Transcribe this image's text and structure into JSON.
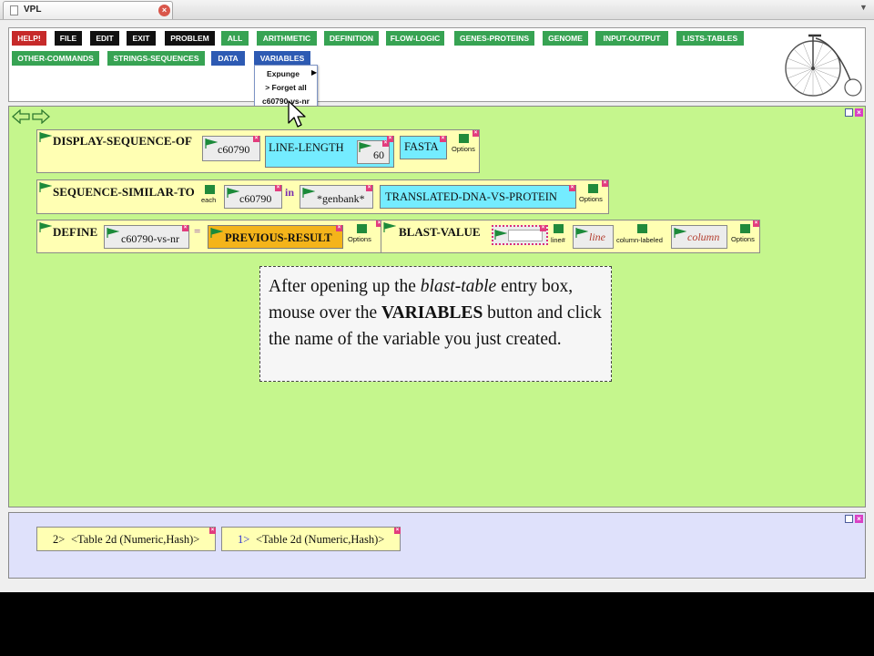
{
  "browser": {
    "tab_title": "VPL"
  },
  "menu_bar": {
    "row1": [
      "HELP!",
      "FILE",
      "EDIT",
      "EXIT",
      "PROBLEM",
      "ALL",
      "ARITHMETIC",
      "DEFINITION",
      "FLOW-LOGIC",
      "GENES-PROTEINS",
      "GENOME",
      "INPUT-OUTPUT",
      "LISTS-TABLES"
    ],
    "row2": [
      "OTHER-COMMANDS",
      "STRINGS-SEQUENCES",
      "DATA",
      "VARIABLES"
    ]
  },
  "variables_menu": {
    "expunge": "Expunge",
    "forget_all": "> Forget all",
    "variable": "c60790-vs-nr"
  },
  "workspace": {
    "block1": {
      "keyword": "DISPLAY-SEQUENCE-OF",
      "arg": "c60790",
      "line_length": "LINE-LENGTH",
      "line_length_value": "60",
      "fasta": "FASTA",
      "options": "Options"
    },
    "block2": {
      "keyword": "SEQUENCE-SIMILAR-TO",
      "each": "each",
      "arg": "c60790",
      "in": "in",
      "db": "*genbank*",
      "method": "TRANSLATED-DNA-VS-PROTEIN",
      "options": "Options"
    },
    "block3": {
      "keyword": "DEFINE",
      "var": "c60790-vs-nr",
      "eq": "=",
      "value": "PREVIOUS-RESULT",
      "options": "Options"
    },
    "block4": {
      "keyword": "BLAST-VALUE",
      "line_label": "line#",
      "line_placeholder": "line",
      "col_label": "column-labeled",
      "col_placeholder": "column",
      "options": "Options"
    }
  },
  "callout": {
    "part1": "After opening up the ",
    "italic": "blast-table",
    "part2": " entry box, mouse over the ",
    "bold": "VARIABLES",
    "part3": " button and click the name of the variable you just created."
  },
  "results": [
    {
      "index": "2>",
      "text": "<Table 2d (Numeric,Hash)>"
    },
    {
      "index": "1>",
      "text": "<Table 2d (Numeric,Hash)>"
    }
  ],
  "colors": {
    "workspace_bg": "#c5f68d",
    "results_bg": "#dfe1fb",
    "menu_green": "#37a353",
    "menu_blue": "#2d5ab3",
    "help_red": "#c62a2a"
  }
}
